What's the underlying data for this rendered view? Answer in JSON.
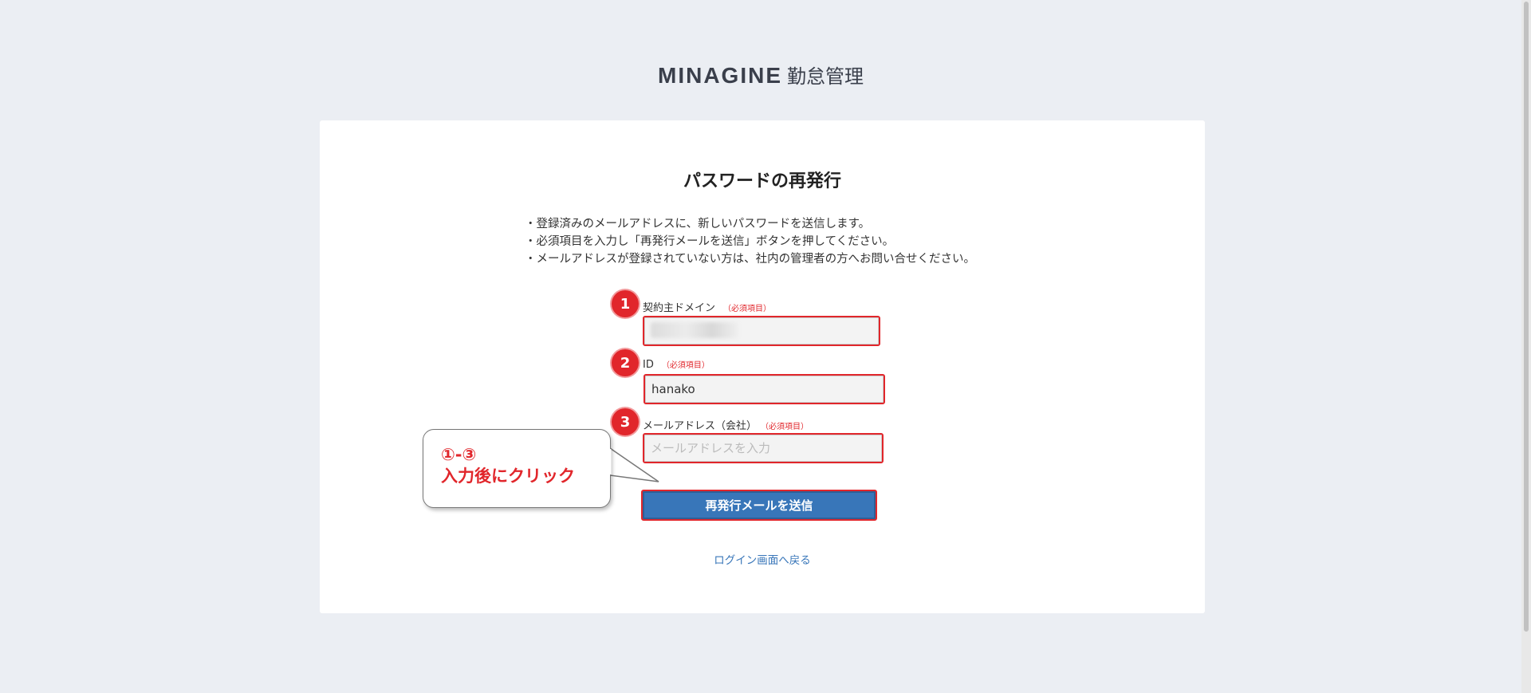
{
  "header": {
    "brand": "MINAGINE",
    "product": "勤怠管理"
  },
  "page": {
    "title": "パスワードの再発行",
    "notes": [
      "・登録済みのメールアドレスに、新しいパスワードを送信します。",
      "・必須項目を入力し「再発行メールを送信」ボタンを押してください。",
      "・メールアドレスが登録されていない方は、社内の管理者の方へお問い合せください。"
    ]
  },
  "form": {
    "required_tag": "（必須項目）",
    "domain": {
      "marker": "1",
      "label": "契約主ドメイン",
      "value": ""
    },
    "id": {
      "marker": "2",
      "label": "ID",
      "value": "hanako"
    },
    "email": {
      "marker": "3",
      "label": "メールアドレス（会社）",
      "value": "",
      "placeholder": "メールアドレスを入力"
    },
    "submit_label": "再発行メールを送信",
    "back_link": "ログイン画面へ戻る"
  },
  "annotation": {
    "line1": "①-③",
    "line2": "入力後にクリック",
    "color": "#e1262b"
  },
  "colors": {
    "background": "#ebeef3",
    "button": "#3876b9",
    "link": "#3876b9",
    "highlight": "#e1262b"
  }
}
